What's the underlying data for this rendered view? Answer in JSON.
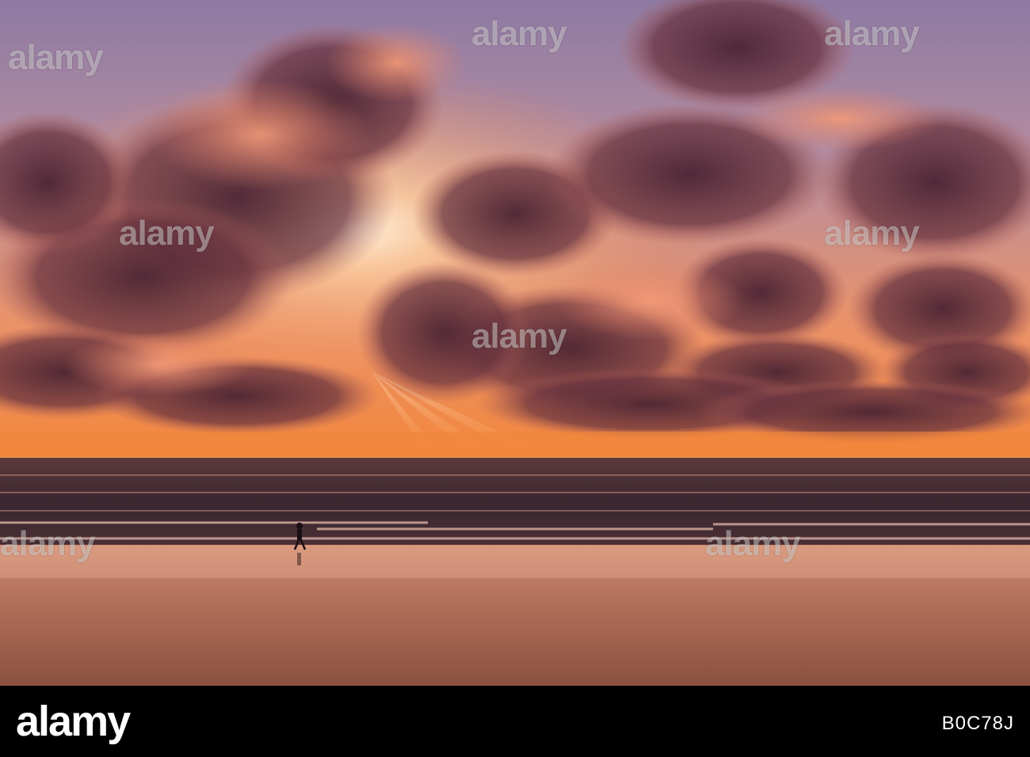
{
  "image": {
    "scene": "beach sunset with dramatic clouds and a lone walker",
    "palette": {
      "sky_top": "#8a6f9a",
      "sky_glow": "#ffd8b0",
      "cloud_dark": "#5a2f3e",
      "cloud_lit": "#e58a6e",
      "horizon": "#f08a40",
      "sea": "#3a2a30",
      "sand_wet": "#c9826a",
      "sand_dry": "#9a6048"
    }
  },
  "watermark": {
    "text": "alamy"
  },
  "footer": {
    "logo": "alamy",
    "image_id": "B0C78J"
  }
}
